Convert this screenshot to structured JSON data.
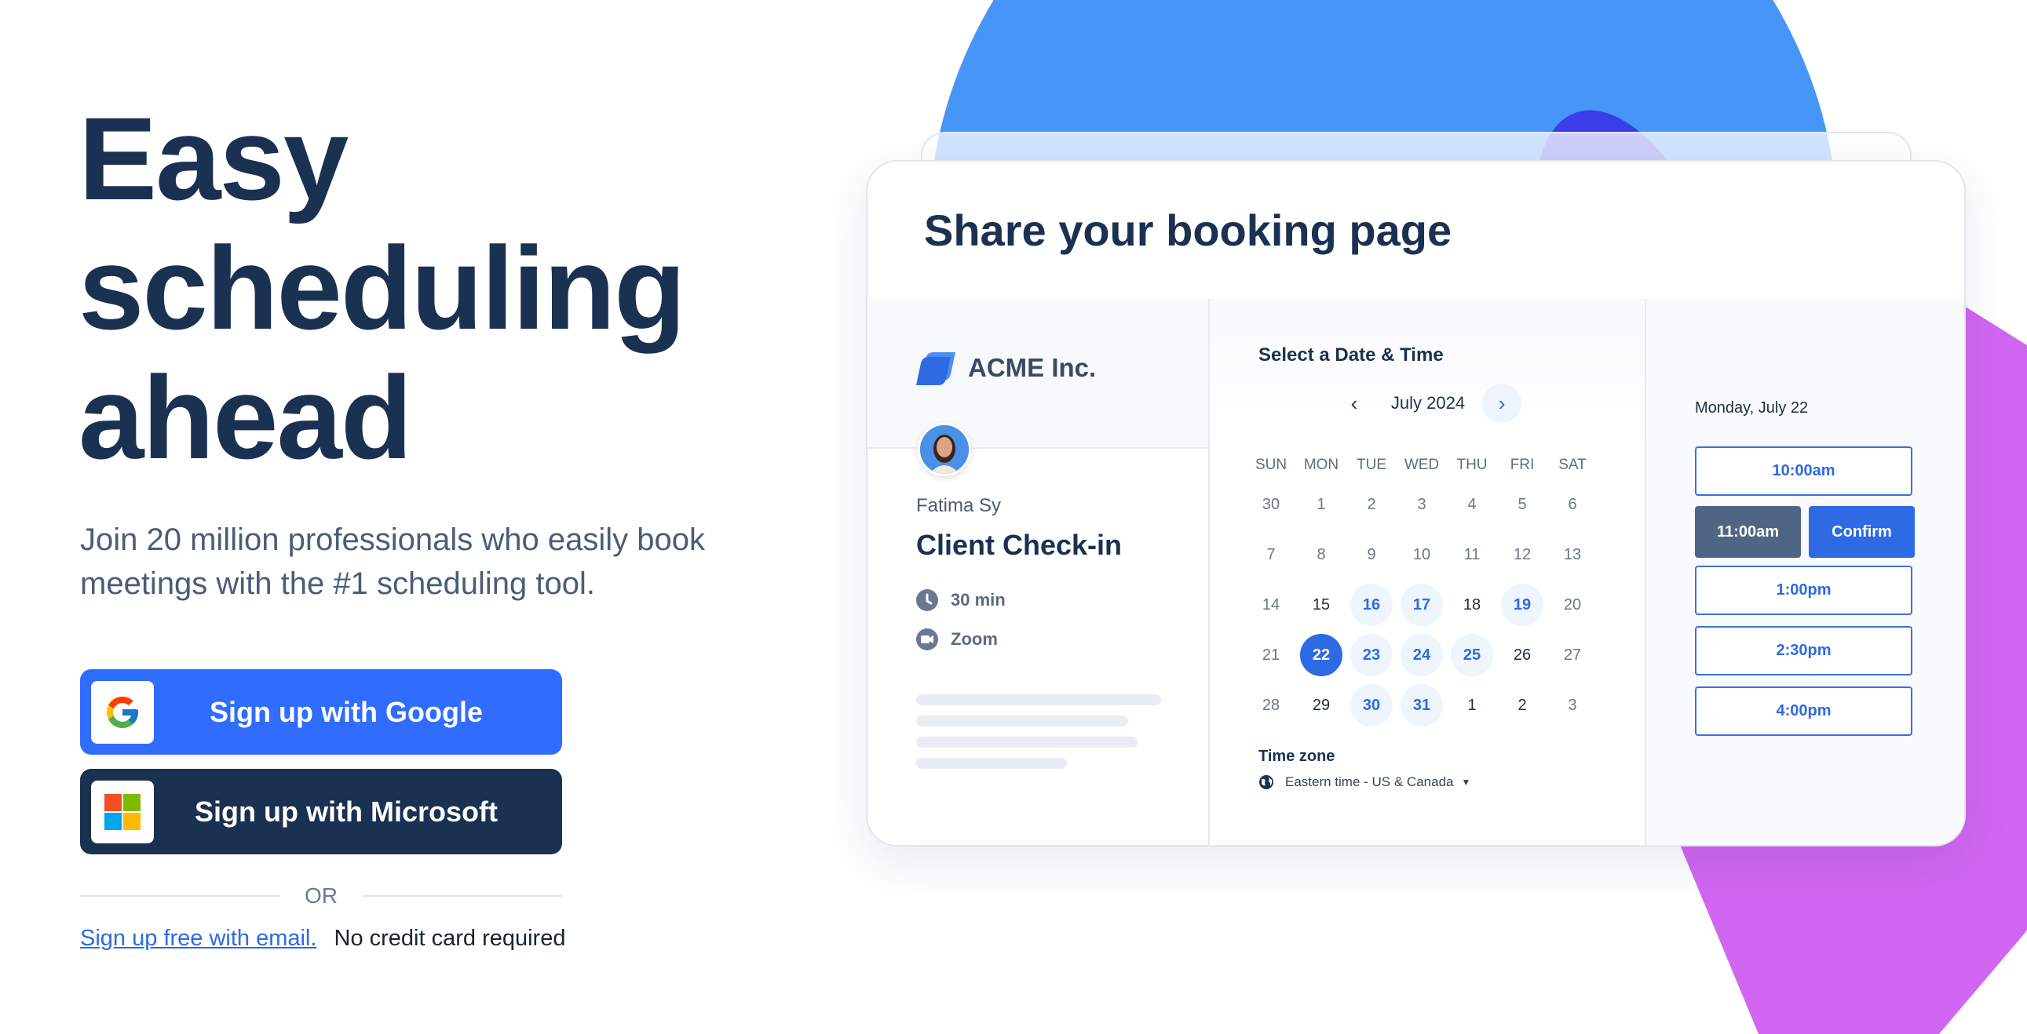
{
  "hero": {
    "headline": [
      "Easy",
      "scheduling",
      "ahead"
    ],
    "subtitle": "Join 20 million professionals who easily book meetings with the #1 scheduling tool.",
    "google_button": "Sign up with Google",
    "microsoft_button": "Sign up with Microsoft",
    "or_label": "OR",
    "email_link": "Sign up free with email.",
    "no_credit_card": "No credit card required"
  },
  "card": {
    "title": "Share your booking page",
    "company": "ACME Inc.",
    "host": "Fatima Sy",
    "event": "Client Check-in",
    "duration": "30 min",
    "location": "Zoom",
    "calendar": {
      "title": "Select a Date & Time",
      "month": "July 2024",
      "weekdays": [
        "SUN",
        "MON",
        "TUE",
        "WED",
        "THU",
        "FRI",
        "SAT"
      ],
      "weeks": [
        [
          {
            "d": "30",
            "s": "muted"
          },
          {
            "d": "1",
            "s": "muted"
          },
          {
            "d": "2",
            "s": "muted"
          },
          {
            "d": "3",
            "s": "muted"
          },
          {
            "d": "4",
            "s": "muted"
          },
          {
            "d": "5",
            "s": "muted"
          },
          {
            "d": "6",
            "s": "muted"
          }
        ],
        [
          {
            "d": "7",
            "s": "muted"
          },
          {
            "d": "8",
            "s": "muted"
          },
          {
            "d": "9",
            "s": "muted"
          },
          {
            "d": "10",
            "s": "muted"
          },
          {
            "d": "11",
            "s": "muted"
          },
          {
            "d": "12",
            "s": "muted"
          },
          {
            "d": "13",
            "s": "muted"
          }
        ],
        [
          {
            "d": "14",
            "s": "muted"
          },
          {
            "d": "15",
            "s": "dark"
          },
          {
            "d": "16",
            "s": "avail"
          },
          {
            "d": "17",
            "s": "avail"
          },
          {
            "d": "18",
            "s": "dark"
          },
          {
            "d": "19",
            "s": "avail"
          },
          {
            "d": "20",
            "s": "muted"
          }
        ],
        [
          {
            "d": "21",
            "s": "muted"
          },
          {
            "d": "22",
            "s": "selected"
          },
          {
            "d": "23",
            "s": "avail"
          },
          {
            "d": "24",
            "s": "avail"
          },
          {
            "d": "25",
            "s": "avail"
          },
          {
            "d": "26",
            "s": "dark"
          },
          {
            "d": "27",
            "s": "muted"
          }
        ],
        [
          {
            "d": "28",
            "s": "muted"
          },
          {
            "d": "29",
            "s": "dark"
          },
          {
            "d": "30",
            "s": "avail"
          },
          {
            "d": "31",
            "s": "avail"
          },
          {
            "d": "1",
            "s": "dark"
          },
          {
            "d": "2",
            "s": "dark"
          },
          {
            "d": "3",
            "s": "muted"
          }
        ]
      ],
      "timezone_label": "Time zone",
      "timezone_value": "Eastern time - US & Canada"
    },
    "times": {
      "date": "Monday, July 22",
      "slots": [
        "10:00am",
        "11:00am",
        "1:00pm",
        "2:30pm",
        "4:00pm"
      ],
      "selected": "11:00am",
      "confirm": "Confirm"
    }
  },
  "colors": {
    "primary": "#306cfe",
    "navy": "#1a3152",
    "circle_blue": "#4596f7",
    "purple": "#d166f2",
    "indigo": "#3a3de8"
  }
}
